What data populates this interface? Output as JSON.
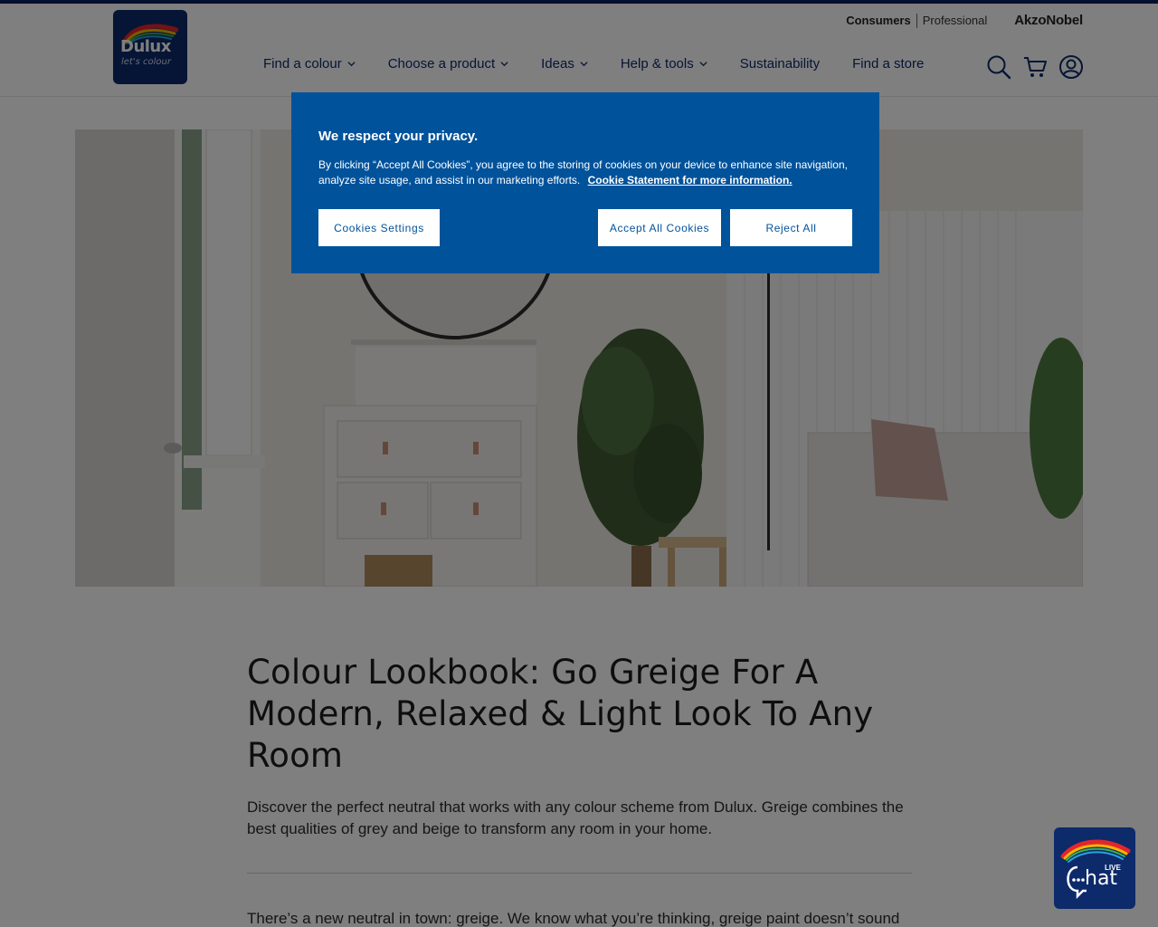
{
  "brand": {
    "name": "Dulux",
    "tagline": "let's colour",
    "colors": {
      "navy": "#0d2a6b",
      "cookie_blue": "#00529b",
      "strip": "#0b1f5c"
    }
  },
  "utility": {
    "consumers": "Consumers",
    "professional": "Professional",
    "parent": "AkzoNobel"
  },
  "nav": [
    {
      "label": "Find a colour",
      "has_menu": true
    },
    {
      "label": "Choose a product",
      "has_menu": true
    },
    {
      "label": "Ideas",
      "has_menu": true
    },
    {
      "label": "Help & tools",
      "has_menu": true
    },
    {
      "label": "Sustainability",
      "has_menu": false
    },
    {
      "label": "Find a store",
      "has_menu": false
    }
  ],
  "header_icons": [
    "search-icon",
    "cart-icon",
    "account-icon"
  ],
  "article": {
    "title": "Colour Lookbook: Go Greige For A Modern, Relaxed & Light Look To Any Room",
    "intro": "Discover the perfect neutral that works with any colour scheme from Dulux. Greige combines the best qualities of grey and beige to transform any room in your home.",
    "body_start": "There’s a new neutral in town: greige. We know what you’re thinking, greige paint doesn’t sound"
  },
  "cookie": {
    "title": "We respect your privacy.",
    "text": "By clicking “Accept All Cookies”, you agree to the storing of cookies on your device to enhance site navigation, analyze site usage, and assist in our marketing efforts.",
    "link": "Cookie Statement for more information.",
    "settings_label": "Cookies Settings",
    "accept_label": "Accept All Cookies",
    "reject_label": "Reject All"
  },
  "chat": {
    "live": "LIVE",
    "label": "hat"
  }
}
